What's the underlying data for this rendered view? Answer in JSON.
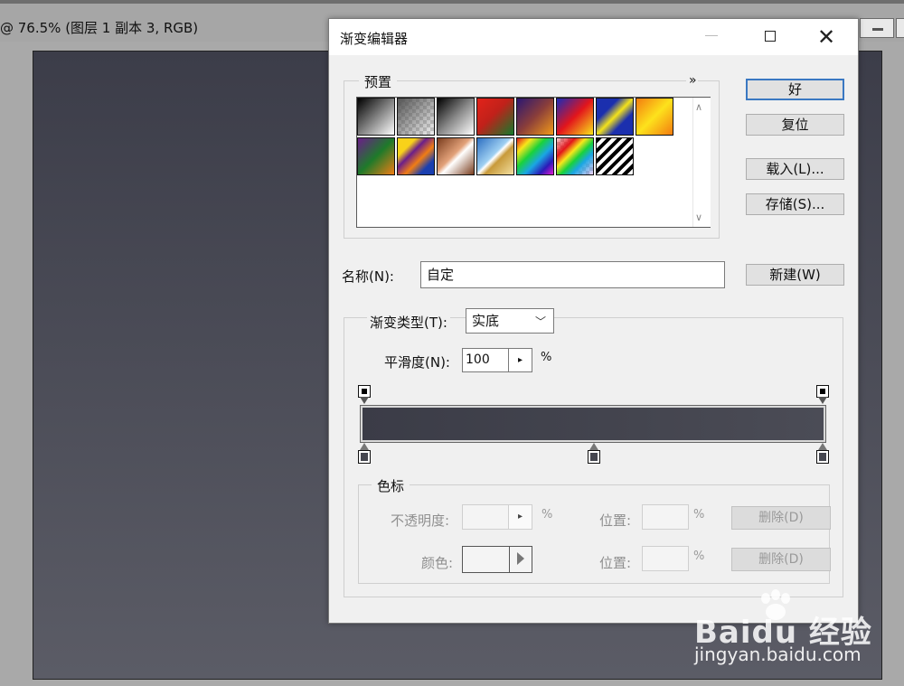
{
  "document": {
    "title": "@ 76.5% (图层 1 副本 3, RGB)"
  },
  "dialog": {
    "title": "渐变编辑器",
    "presets": {
      "legend": "预置",
      "menu_arrow": "»",
      "swatches": [
        "black-white",
        "transparent-checker",
        "black-white-2",
        "red-green",
        "violet-orange",
        "blue-red-yellow",
        "blue-yellow-blue",
        "orange-yellow-orange",
        "violet-green-orange",
        "yellow-violet-orange-blue",
        "copper",
        "chrome",
        "spectrum",
        "transparent-rainbow",
        "transparent-stripes"
      ]
    },
    "buttons": {
      "ok": "好",
      "reset": "复位",
      "load": "载入(L)...",
      "save": "存储(S)...",
      "new": "新建(W)"
    },
    "name": {
      "label": "名称(N):",
      "value": "自定"
    },
    "gradient_type": {
      "label": "渐变类型(T):",
      "value": "实底"
    },
    "smoothness": {
      "label": "平滑度(N):",
      "value": "100",
      "unit": "%"
    },
    "color_stops": {
      "legend": "色标",
      "opacity_label": "不透明度:",
      "opacity_unit": "%",
      "location_label": "位置:",
      "location_unit": "%",
      "delete_label": "删除(D)",
      "color_label": "颜色:"
    },
    "colors": {
      "gradient_start": "#3b3c47",
      "gradient_end": "#4b4c56",
      "ok_border": "#3a78c2"
    }
  },
  "watermark": {
    "logo": "Baidu 经验",
    "url": "jingyan.baidu.com"
  }
}
